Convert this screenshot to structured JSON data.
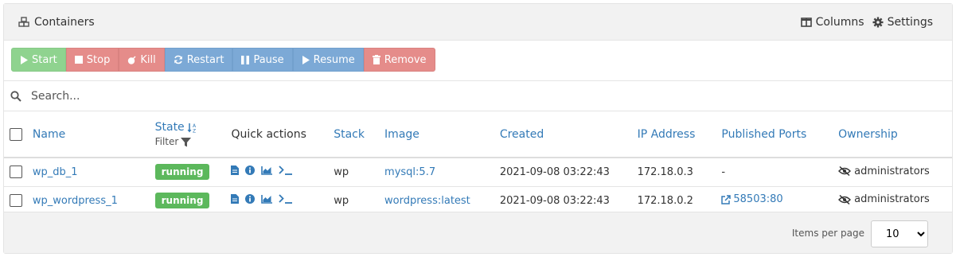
{
  "header": {
    "title": "Containers",
    "columns_label": "Columns",
    "settings_label": "Settings"
  },
  "toolbar": {
    "buttons": [
      {
        "label": "Start",
        "color": "#8fd38f"
      },
      {
        "label": "Stop",
        "color": "#e58c8a"
      },
      {
        "label": "Kill",
        "color": "#e58c8a"
      },
      {
        "label": "Restart",
        "color": "#7ca9d6"
      },
      {
        "label": "Pause",
        "color": "#7ca9d6"
      },
      {
        "label": "Resume",
        "color": "#7ca9d6"
      },
      {
        "label": "Remove",
        "color": "#e58c8a"
      }
    ]
  },
  "search": {
    "placeholder": "Search..."
  },
  "table": {
    "columns": {
      "name": "Name",
      "state": "State",
      "filter": "Filter",
      "quick_actions": "Quick actions",
      "stack": "Stack",
      "image": "Image",
      "created": "Created",
      "ip": "IP Address",
      "ports": "Published Ports",
      "ownership": "Ownership"
    },
    "rows": [
      {
        "name": "wp_db_1",
        "state": "running",
        "stack": "wp",
        "image": "mysql:5.7",
        "created": "2021-09-08 03:22:43",
        "ip": "172.18.0.3",
        "ports": "-",
        "ownership": "administrators"
      },
      {
        "name": "wp_wordpress_1",
        "state": "running",
        "stack": "wp",
        "image": "wordpress:latest",
        "created": "2021-09-08 03:22:43",
        "ip": "172.18.0.2",
        "ports": "58503:80",
        "ownership": "administrators"
      }
    ]
  },
  "footer": {
    "items_per_page_label": "Items per page",
    "items_per_page_value": "10"
  },
  "colors": {
    "accent": "#337ab7",
    "running": "#5cb85c",
    "success_btn": "#8fd38f",
    "danger_btn": "#e58c8a",
    "primary_btn": "#7ca9d6"
  }
}
